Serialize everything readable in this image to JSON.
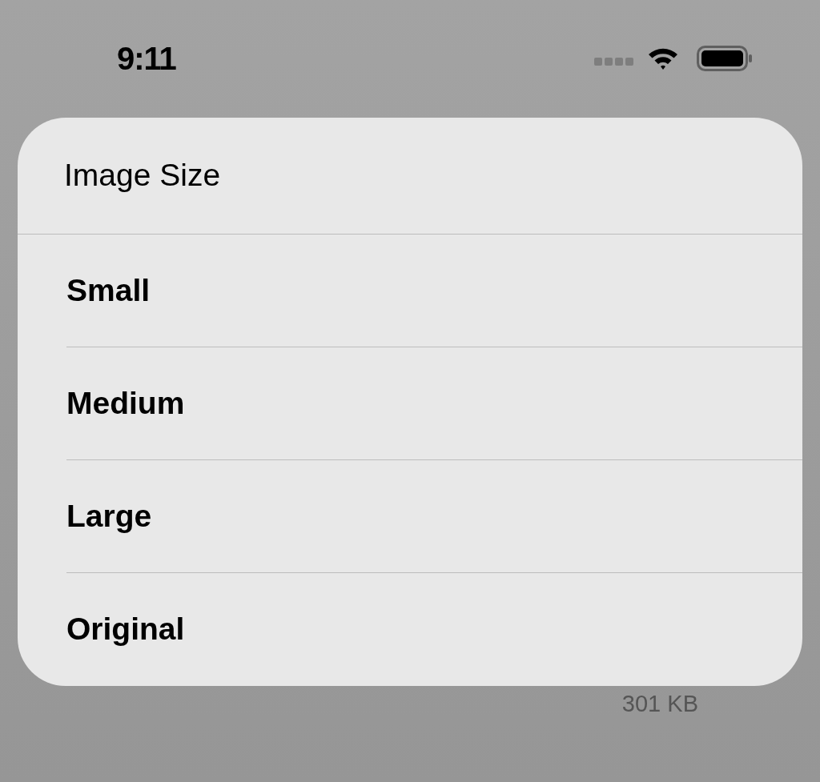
{
  "status_bar": {
    "time": "9:11"
  },
  "sheet": {
    "title": "Image Size",
    "options": [
      {
        "label": "Small"
      },
      {
        "label": "Medium"
      },
      {
        "label": "Large"
      },
      {
        "label": "Original"
      }
    ]
  },
  "background": {
    "file_size": "301 KB"
  }
}
